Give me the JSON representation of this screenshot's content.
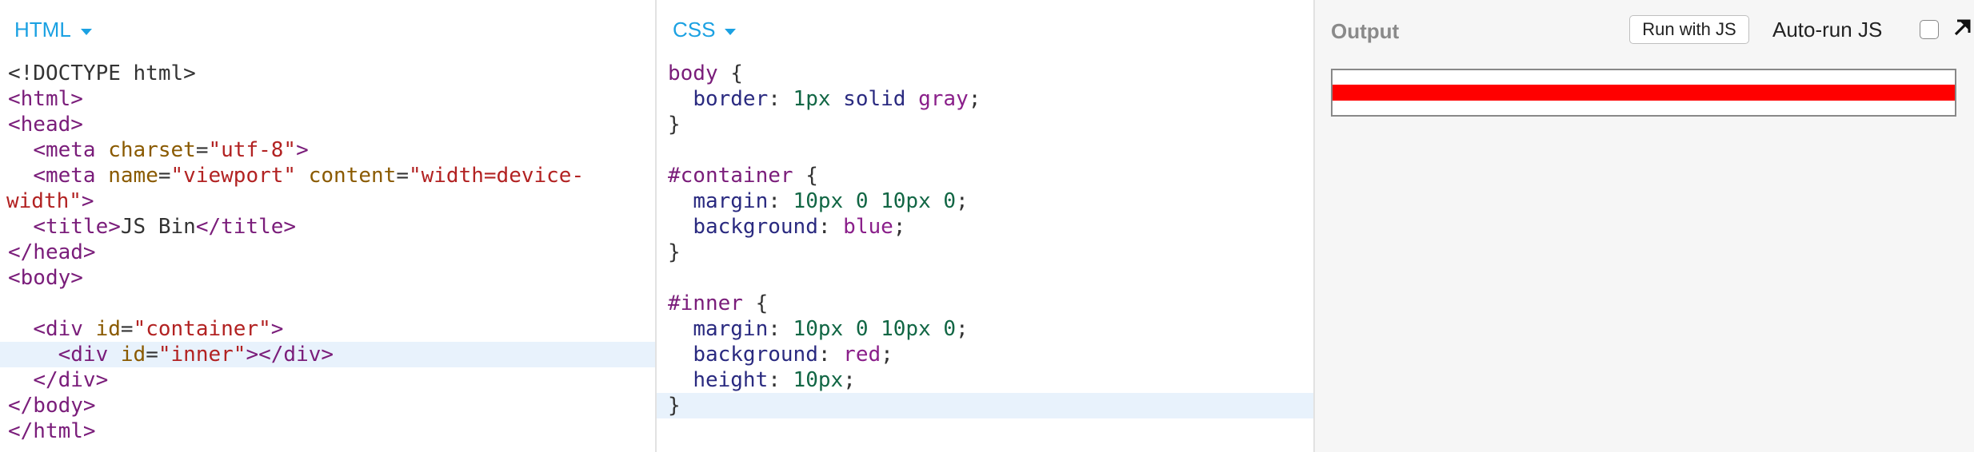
{
  "panels": {
    "html": {
      "label": "HTML"
    },
    "css": {
      "label": "CSS"
    },
    "output": {
      "title": "Output",
      "run_button": "Run with JS",
      "autorun_label": "Auto-run JS",
      "autorun_checked": false,
      "popout_icon": "popout-arrow-icon",
      "preview_bar_color": "#ff0000"
    }
  },
  "html_code": {
    "l1": "<!DOCTYPE html>",
    "l2_tag": "<html>",
    "l3_tag": "<head>",
    "l4_tag_open": "<meta",
    "l4_attr": "charset",
    "l4_eq": "=",
    "l4_val": "\"utf-8\"",
    "l4_close": ">",
    "l5_tag_open": "<meta",
    "l5_attr1": "name",
    "l5_val1": "\"viewport\"",
    "l5_attr2": "content",
    "l5_val2": "\"width=device-",
    "l6_val": "width\"",
    "l6_close": ">",
    "l7_open": "<title>",
    "l7_text": "JS Bin",
    "l7_close": "</title>",
    "l8_tag": "</head>",
    "l9_tag": "<body>",
    "l11_tag_open": "<div",
    "l11_attr": "id",
    "l11_val": "\"container\"",
    "l11_close": ">",
    "l12_tag_open": "<div",
    "l12_attr": "id",
    "l12_val": "\"inner\"",
    "l12_close": "></div>",
    "l13_tag": "</div>",
    "l14_tag": "</body>",
    "l15_tag": "</html>"
  },
  "css_code": {
    "r1": {
      "selector": "body",
      "open": " {"
    },
    "r1_d1": {
      "prop": "border",
      "num": "1px",
      "rest": "solid",
      "val": "gray"
    },
    "r1_close": "}",
    "r2": {
      "selector": "#container",
      "open": " {"
    },
    "r2_d1": {
      "prop": "margin",
      "value": "10px 0 10px 0"
    },
    "r2_d2": {
      "prop": "background",
      "val": "blue"
    },
    "r2_close": "}",
    "r3": {
      "selector": "#inner",
      "open": " {"
    },
    "r3_d1": {
      "prop": "margin",
      "value": "10px 0 10px 0"
    },
    "r3_d2": {
      "prop": "background",
      "val": "red"
    },
    "r3_d3": {
      "prop": "height",
      "value": "10px"
    },
    "r3_close": "}"
  }
}
